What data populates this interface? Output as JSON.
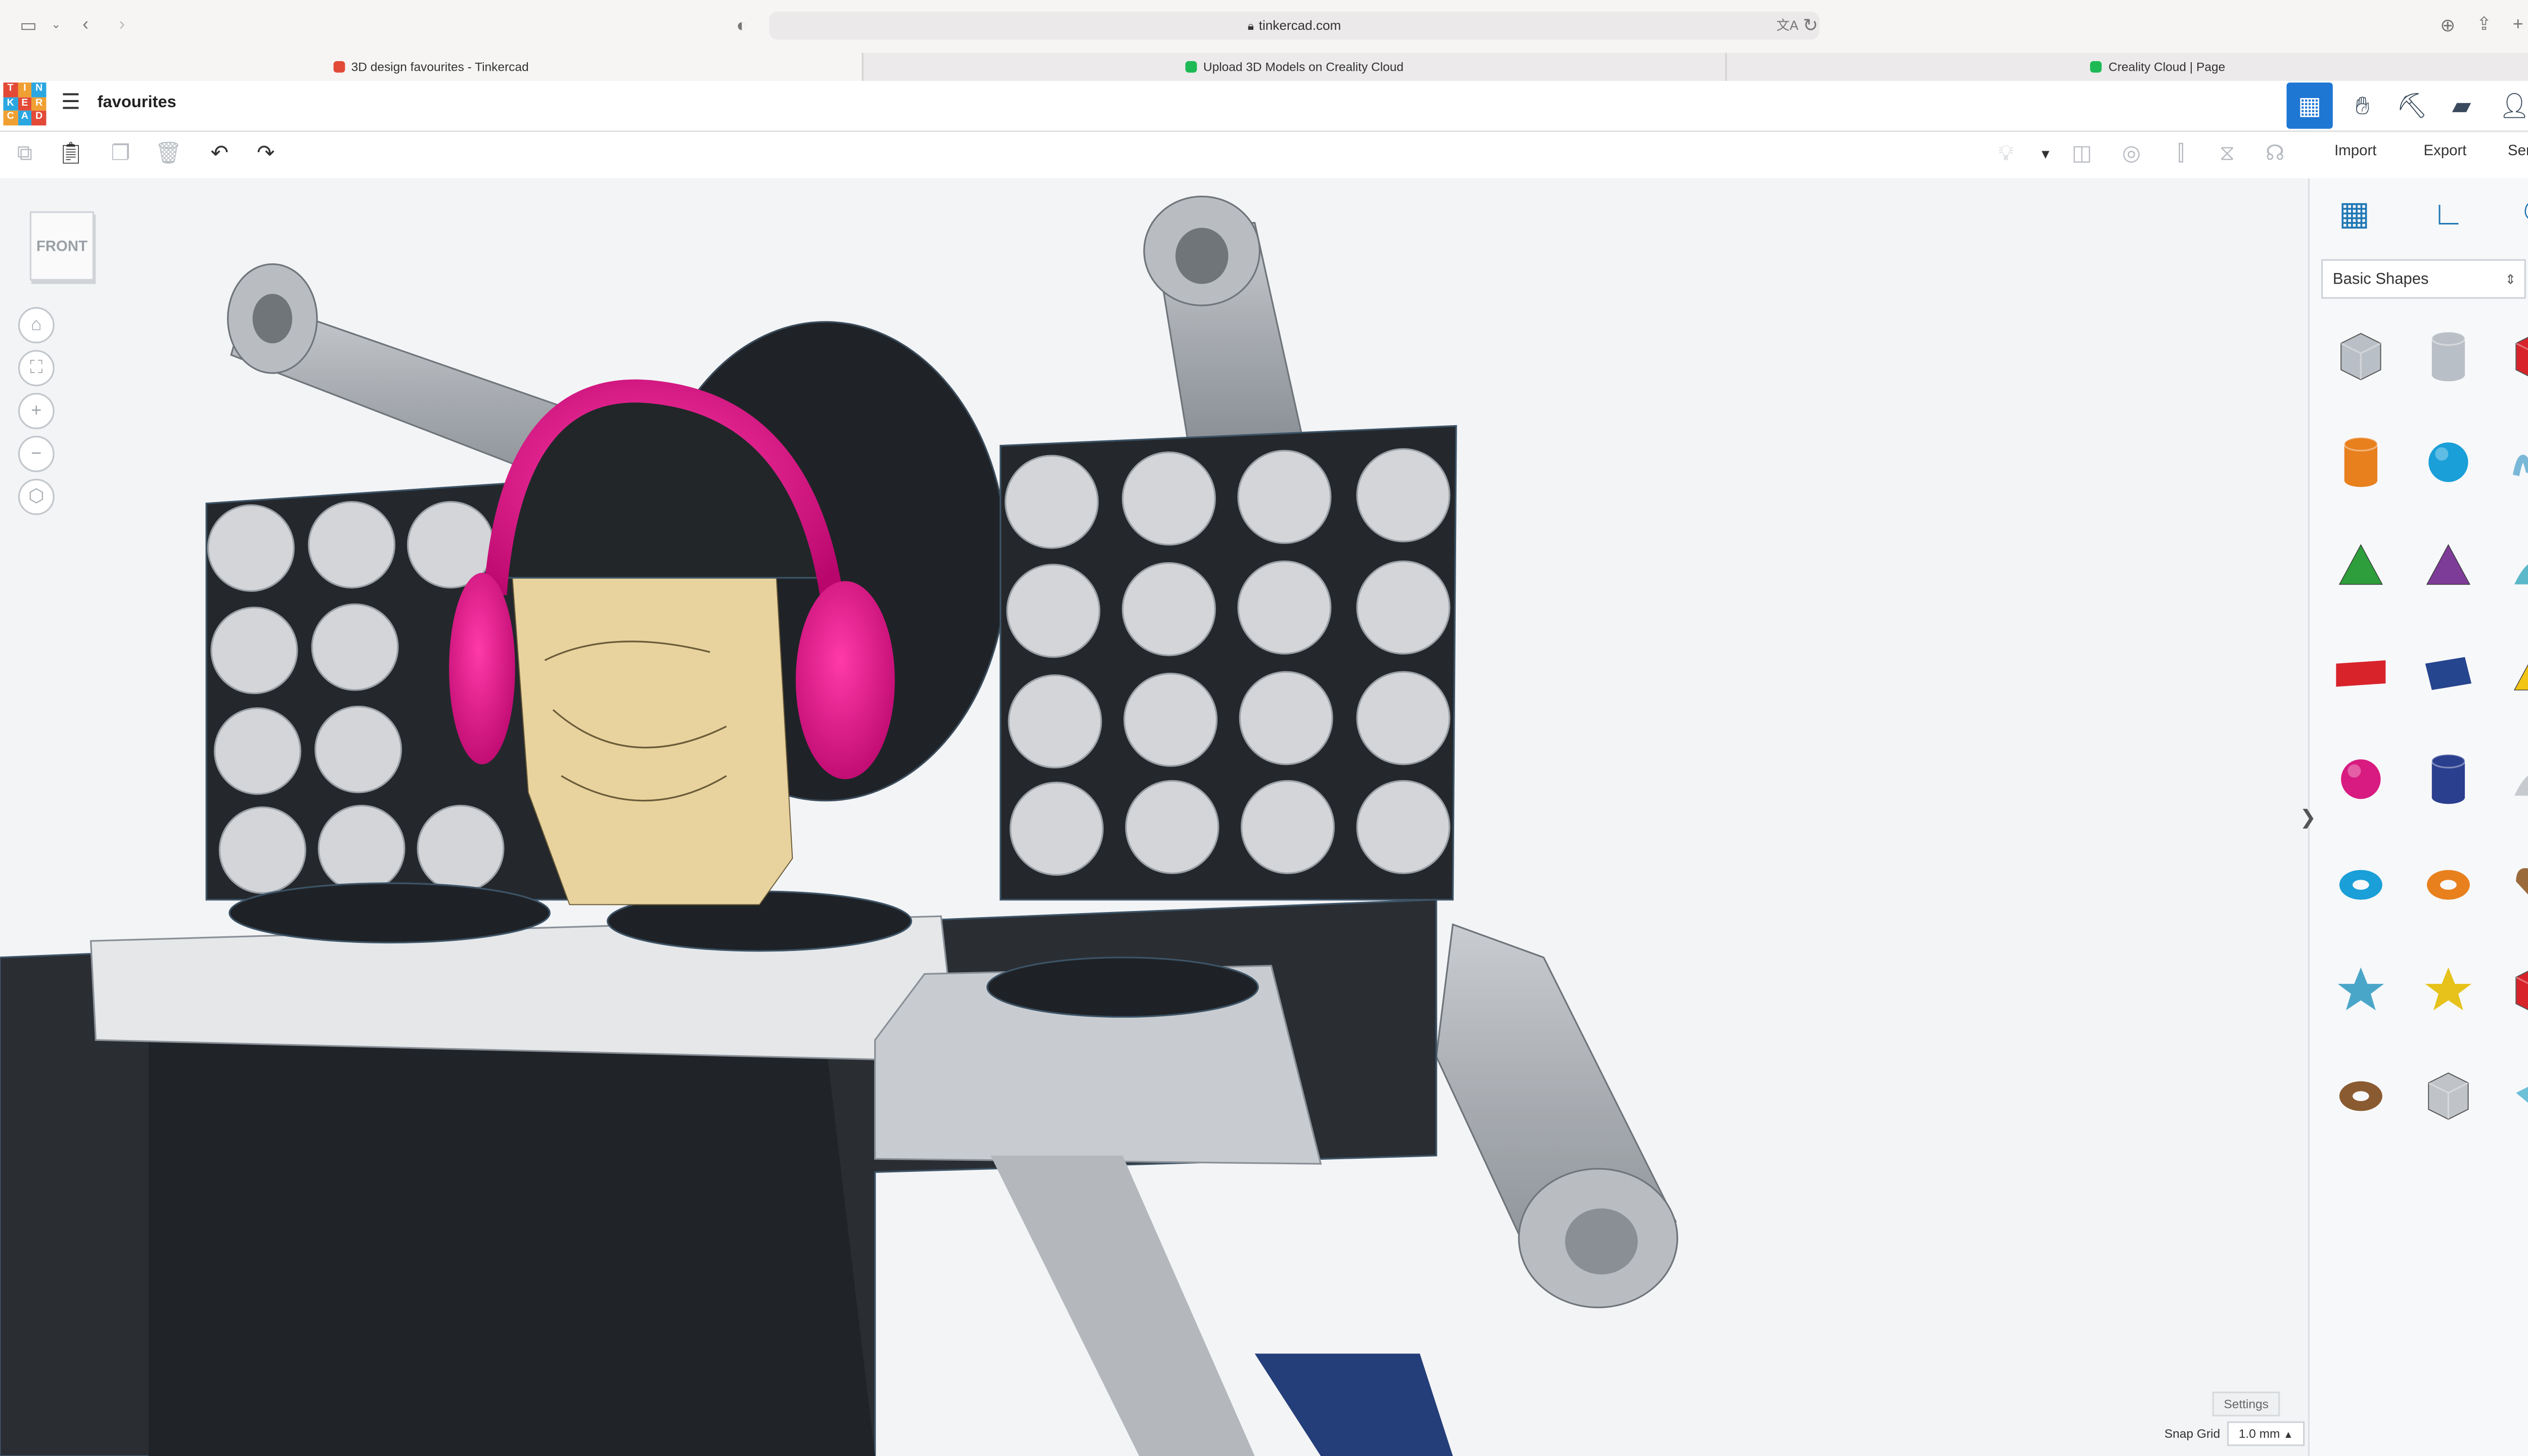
{
  "browser": {
    "url": "tinkercad.com",
    "tabs": [
      {
        "title": "3D design favourites - Tinkercad",
        "favicon_color": "#e24a37"
      },
      {
        "title": "Upload 3D Models on Creality Cloud",
        "favicon_color": "#1db954"
      },
      {
        "title": "Creality Cloud | Page",
        "favicon_color": "#1db954"
      }
    ]
  },
  "app": {
    "logo_letters": [
      "T",
      "I",
      "N",
      "K",
      "E",
      "R",
      "C",
      "A",
      "D"
    ],
    "logo_colors": [
      "#e24a37",
      "#f0a032",
      "#2aa7e1",
      "#e24a37",
      "#f0a032",
      "#2aa7e1",
      "#f0a032",
      "#2aa7e1",
      "#e24a37"
    ],
    "project_name": "favourites",
    "accent": "#1f77d4"
  },
  "toolbar": {
    "import_label": "Import",
    "export_label": "Export",
    "send_to_label": "Send To"
  },
  "viewport": {
    "viewcube_label": "FRONT",
    "settings_label": "Settings",
    "snap_grid_label": "Snap Grid",
    "snap_grid_value": "1.0 mm"
  },
  "panel": {
    "shape_category": "Basic Shapes",
    "shapes": [
      {
        "name": "box-hole",
        "color": "#b9bfc6"
      },
      {
        "name": "cylinder-hole",
        "color": "#b9bfc6"
      },
      {
        "name": "box",
        "color": "#d8232a"
      },
      {
        "name": "cylinder",
        "color": "#e8801e"
      },
      {
        "name": "sphere",
        "color": "#1a9fd8"
      },
      {
        "name": "scribble",
        "color": "#7ab8d8"
      },
      {
        "name": "roof",
        "color": "#2e9d3b"
      },
      {
        "name": "cone",
        "color": "#7d3c98"
      },
      {
        "name": "round-roof",
        "color": "#5bb8c9"
      },
      {
        "name": "text",
        "color": "#d8232a"
      },
      {
        "name": "wedge",
        "color": "#26458f"
      },
      {
        "name": "pyramid",
        "color": "#f2c413"
      },
      {
        "name": "half-sphere",
        "color": "#d81b80"
      },
      {
        "name": "polygon",
        "color": "#2b3f8f"
      },
      {
        "name": "paraboloid",
        "color": "#c7cbd0"
      },
      {
        "name": "torus",
        "color": "#1a9fd8"
      },
      {
        "name": "tube",
        "color": "#e8801e"
      },
      {
        "name": "heart",
        "color": "#9a6a3a"
      },
      {
        "name": "star",
        "color": "#4aa6c8"
      },
      {
        "name": "star-6",
        "color": "#e6c21a"
      },
      {
        "name": "icosahedron",
        "color": "#d8232a"
      },
      {
        "name": "ring",
        "color": "#8a5a30"
      },
      {
        "name": "round-cube",
        "color": "#c0c4c8"
      },
      {
        "name": "diamond",
        "color": "#6cc0d8"
      }
    ]
  }
}
